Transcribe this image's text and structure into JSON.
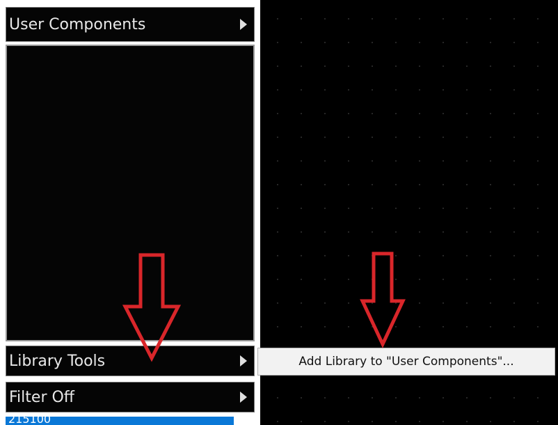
{
  "panel": {
    "user_components_label": "User Components",
    "library_tools_label": "Library Tools",
    "filter_label": "Filter Off",
    "selected_item_text": "215100"
  },
  "context_menu": {
    "add_library_label": "Add Library to \"User Components\"..."
  },
  "colors": {
    "annotation_arrow": "#d9262a",
    "selection": "#0a78d7",
    "panel_background": "#050505"
  }
}
